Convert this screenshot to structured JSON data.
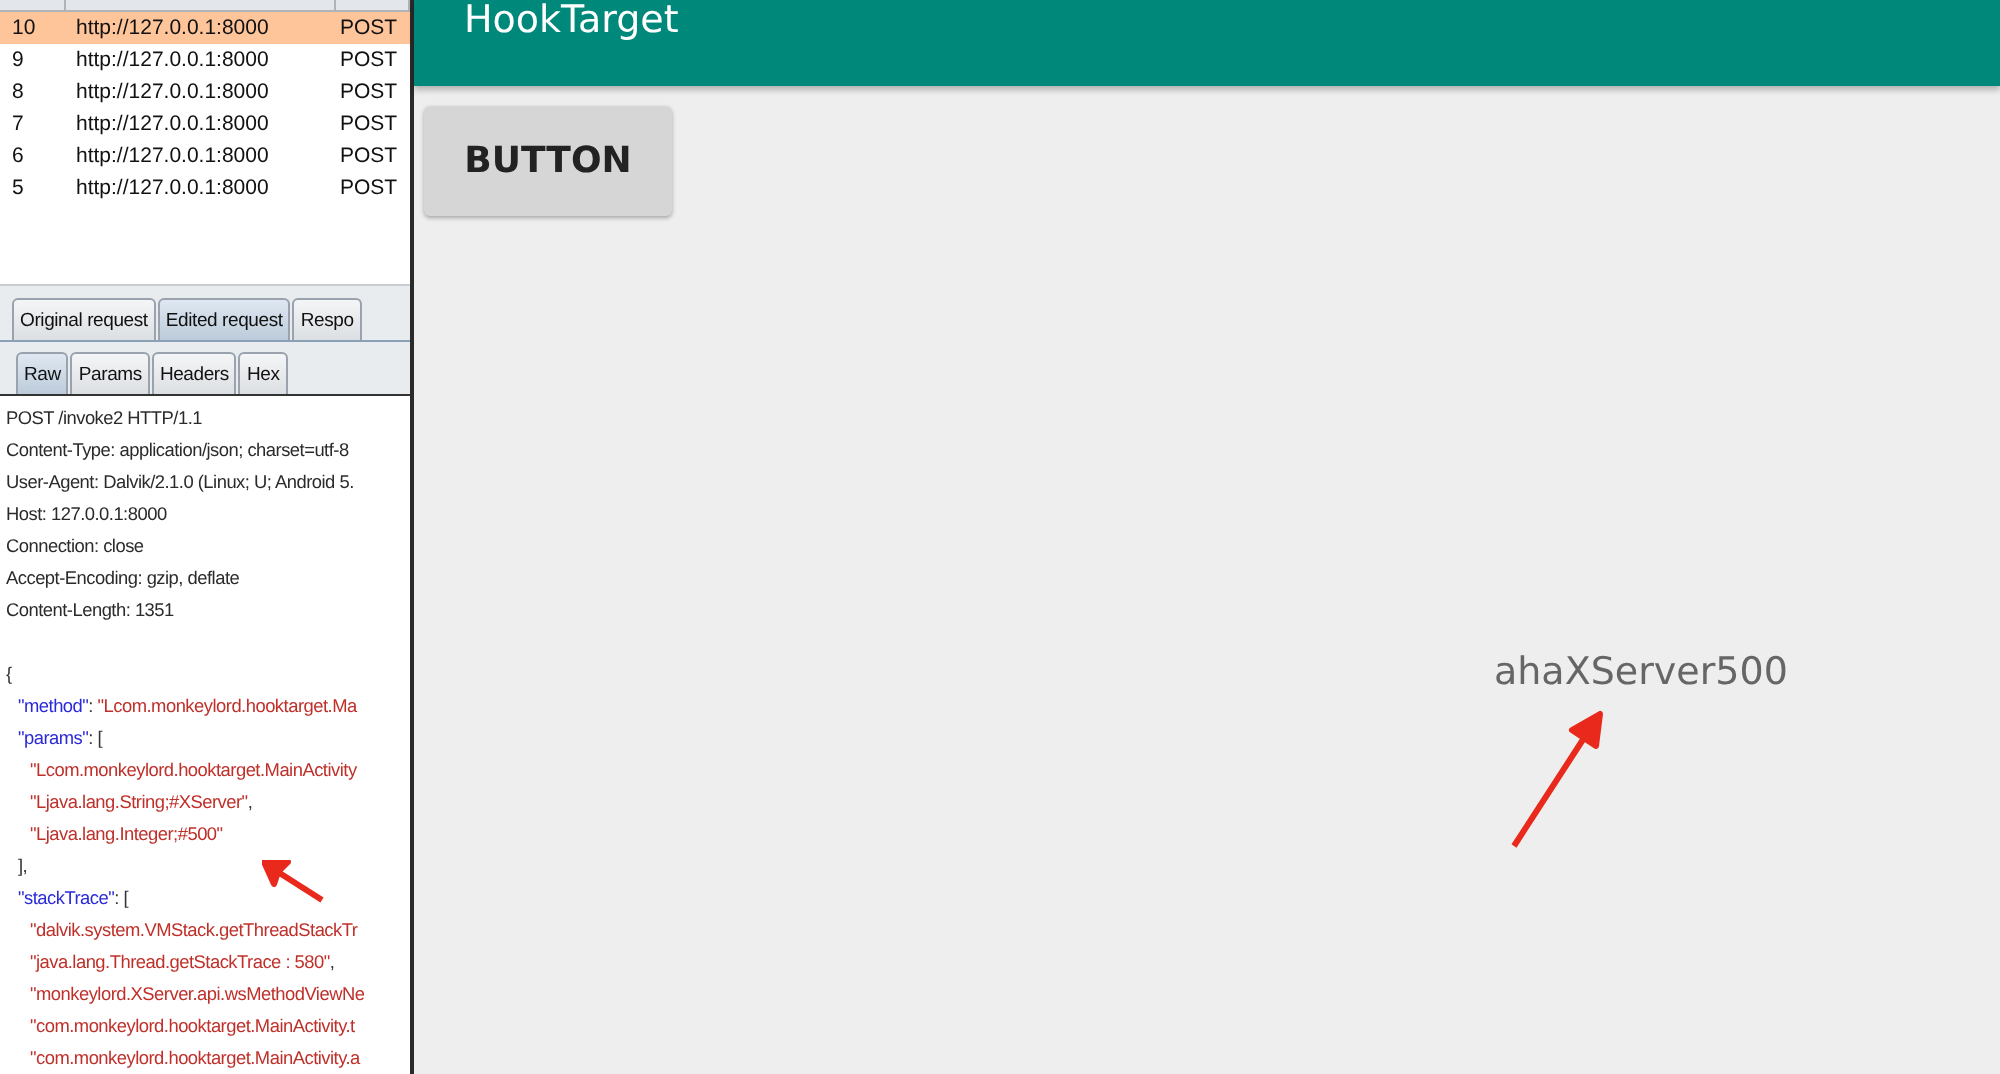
{
  "history": {
    "rows": [
      {
        "number": "10",
        "host": "http://127.0.0.1:8000",
        "method": "POST",
        "selected": true
      },
      {
        "number": "9",
        "host": "http://127.0.0.1:8000",
        "method": "POST",
        "selected": false
      },
      {
        "number": "8",
        "host": "http://127.0.0.1:8000",
        "method": "POST",
        "selected": false
      },
      {
        "number": "7",
        "host": "http://127.0.0.1:8000",
        "method": "POST",
        "selected": false
      },
      {
        "number": "6",
        "host": "http://127.0.0.1:8000",
        "method": "POST",
        "selected": false
      },
      {
        "number": "5",
        "host": "http://127.0.0.1:8000",
        "method": "POST",
        "selected": false
      }
    ]
  },
  "request_tabs": [
    {
      "label": "Original request",
      "selected": false
    },
    {
      "label": "Edited request",
      "selected": true
    },
    {
      "label": "Respo",
      "selected": false
    }
  ],
  "view_tabs": [
    {
      "label": "Raw",
      "selected": true
    },
    {
      "label": "Params",
      "selected": false
    },
    {
      "label": "Headers",
      "selected": false
    },
    {
      "label": "Hex",
      "selected": false
    }
  ],
  "headers": [
    "POST /invoke2 HTTP/1.1",
    "Content-Type: application/json; charset=utf-8",
    "User-Agent: Dalvik/2.1.0 (Linux; U; Android 5.",
    "Host: 127.0.0.1:8000",
    "Connection: close",
    "Accept-Encoding: gzip, deflate",
    "Content-Length: 1351"
  ],
  "body": [
    {
      "parts": [
        {
          "kind": "plain",
          "text": "{"
        }
      ],
      "children": [
        {
          "parts": [
            {
              "kind": "key",
              "text": "\"method\""
            },
            {
              "kind": "plain",
              "text": ": "
            },
            {
              "kind": "string",
              "text": "\"Lcom.monkeylord.hooktarget.Ma"
            }
          ]
        },
        {
          "parts": [
            {
              "kind": "key",
              "text": "\"params\""
            },
            {
              "kind": "plain",
              "text": ": ["
            }
          ],
          "children": [
            {
              "parts": [
                {
                  "kind": "string",
                  "text": "\"Lcom.monkeylord.hooktarget.MainActivity"
                }
              ]
            },
            {
              "parts": [
                {
                  "kind": "string",
                  "text": "\"Ljava.lang.String;#XServer\""
                },
                {
                  "kind": "plain",
                  "text": ","
                }
              ]
            },
            {
              "parts": [
                {
                  "kind": "string",
                  "text": "\"Ljava.lang.Integer;#500\""
                }
              ]
            }
          ]
        },
        {
          "parts": [
            {
              "kind": "plain",
              "text": "],"
            }
          ]
        },
        {
          "parts": [
            {
              "kind": "key",
              "text": "\"stackTrace\""
            },
            {
              "kind": "plain",
              "text": ": ["
            }
          ],
          "children": [
            {
              "parts": [
                {
                  "kind": "string",
                  "text": "\"dalvik.system.VMStack.getThreadStackTr"
                }
              ]
            },
            {
              "parts": [
                {
                  "kind": "string",
                  "text": "\"java.lang.Thread.getStackTrace : 580\""
                },
                {
                  "kind": "plain",
                  "text": ","
                }
              ]
            },
            {
              "parts": [
                {
                  "kind": "string",
                  "text": "\"monkeylord.XServer.api.wsMethodViewNe"
                }
              ]
            },
            {
              "parts": [
                {
                  "kind": "string",
                  "text": "\"com.monkeylord.hooktarget.MainActivity.t"
                }
              ]
            },
            {
              "parts": [
                {
                  "kind": "string",
                  "text": "\"com.monkeylord.hooktarget.MainActivity.a"
                }
              ]
            }
          ]
        }
      ]
    }
  ],
  "app": {
    "title": "HookTarget",
    "button": "BUTTON",
    "output": "ahaXServer500"
  }
}
